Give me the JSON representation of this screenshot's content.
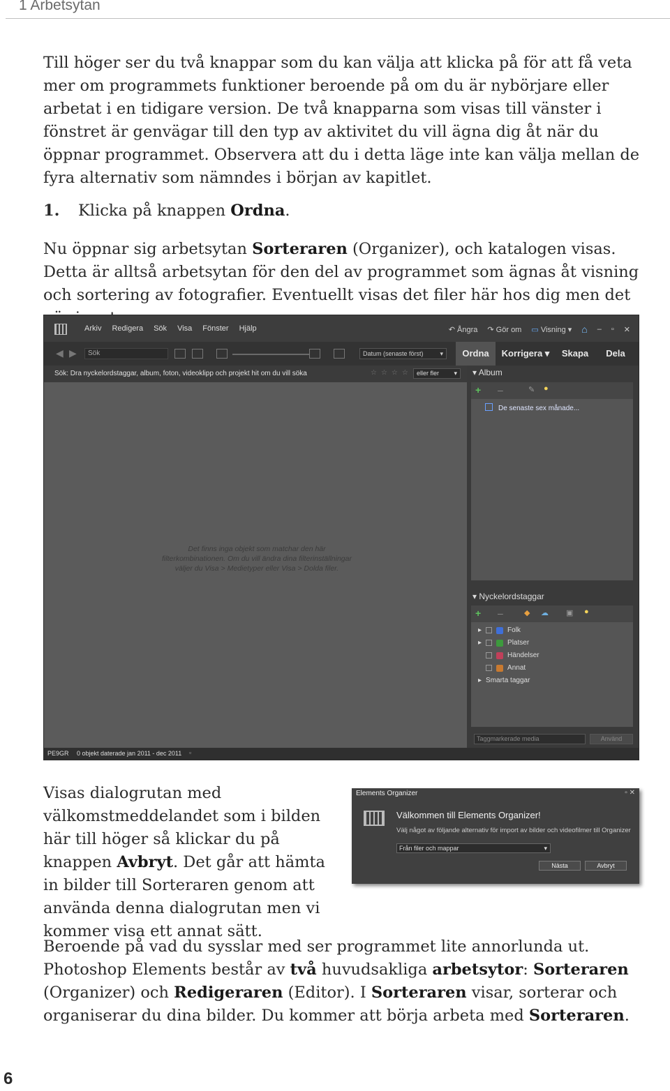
{
  "header": {
    "label": "1 Arbetsytan"
  },
  "intro_paragraph": "Till höger ser du två knappar som du kan välja att klicka på för att få veta mer om programmets funktioner beroende på om du är nybörjare eller arbetat i en tidigare version. De två knapparna som visas till vänster i fönstret är genvägar till den typ av aktivitet du vill ägna dig åt när du öppnar programmet. Observera att du i detta läge inte kan välja mellan de fyra alternativ som nämndes i början av kapitlet.",
  "step": {
    "number": "1.",
    "text_before": "Klicka på knappen ",
    "bold": "Ordna",
    "text_after": "."
  },
  "organizer_paragraph": {
    "text_before": "Nu öppnar sig arbetsytan ",
    "bold": "Sorteraren",
    "text_after": " (Organizer), och katalogen visas. Detta är alltså arbetsytan för den del av programmet som ägnas åt visning och sortering av fotografier. Eventuellt visas det filer här hos dig men det gör inget."
  },
  "app": {
    "menu": [
      "Arkiv",
      "Redigera",
      "Sök",
      "Visa",
      "Fönster",
      "Hjälp"
    ],
    "undo": "Ångra",
    "redo": "Gör om",
    "display": "Visning",
    "search_placeholder": "Sök",
    "sort": "Datum (senaste först)",
    "tabs": [
      "Ordna",
      "Korrigera",
      "Skapa",
      "Dela"
    ],
    "filter_text": "Sök: Dra nyckelordstaggar, album, foton, videoklipp och projekt hit om du vill söka",
    "filter_mode": "eller fler",
    "stars": "☆☆☆☆☆",
    "empty_message": "Det finns inga objekt som matchar den här filterkombinationen. Om du vill ändra dina filterinställningar väljer du Visa > Medietyper eller Visa > Dolda filer.",
    "album_heading": "Album",
    "album_item": "De senaste sex månade...",
    "keywords_heading": "Nyckelordstaggar",
    "keywords": [
      {
        "label": "Folk",
        "color": "#3f6fd8"
      },
      {
        "label": "Platser",
        "color": "#3d9a3d"
      },
      {
        "label": "Händelser",
        "color": "#c0405a"
      },
      {
        "label": "Annat",
        "color": "#c87a30"
      }
    ],
    "smart_tags": "Smarta taggar",
    "tagged_media": "Taggmarkerade media",
    "apply": "Använd",
    "status_id": "PE9GR",
    "status_text": "0 objekt daterade jan 2011 - dec 2011"
  },
  "dialog_paragraph": {
    "text_before": "Visas dialogrutan med välkomstmeddelandet som i bilden här till höger så klickar du på knappen ",
    "bold": "Avbryt",
    "text_after": ". Det går att hämta in bilder till Sorteraren genom att använda denna dialogrutan men vi kommer visa ett annat sätt."
  },
  "dialog": {
    "title": "Elements Organizer",
    "heading": "Välkommen till Elements Organizer!",
    "subtext": "Välj något av följande alternativ för import av bilder och videofilmer till Organizer",
    "select_value": "Från filer och mappar",
    "next": "Nästa",
    "cancel": "Avbryt"
  },
  "closing_paragraph": {
    "t1": "Beroende på vad du sysslar med ser programmet lite annorlunda ut. Photoshop Elements består av ",
    "b1": "två",
    "t2": " huvudsakliga ",
    "b2": "arbetsytor",
    "t3": ": ",
    "b3": "Sorteraren",
    "t4": " (Organizer) och ",
    "b4": "Redigeraren",
    "t5": " (Editor). I ",
    "b5": "Sorteraren",
    "t6": " visar, sorterar och organiserar du dina bilder. Du kommer att börja arbeta med ",
    "b6": "Sorteraren",
    "t7": "."
  },
  "page_number": "6"
}
